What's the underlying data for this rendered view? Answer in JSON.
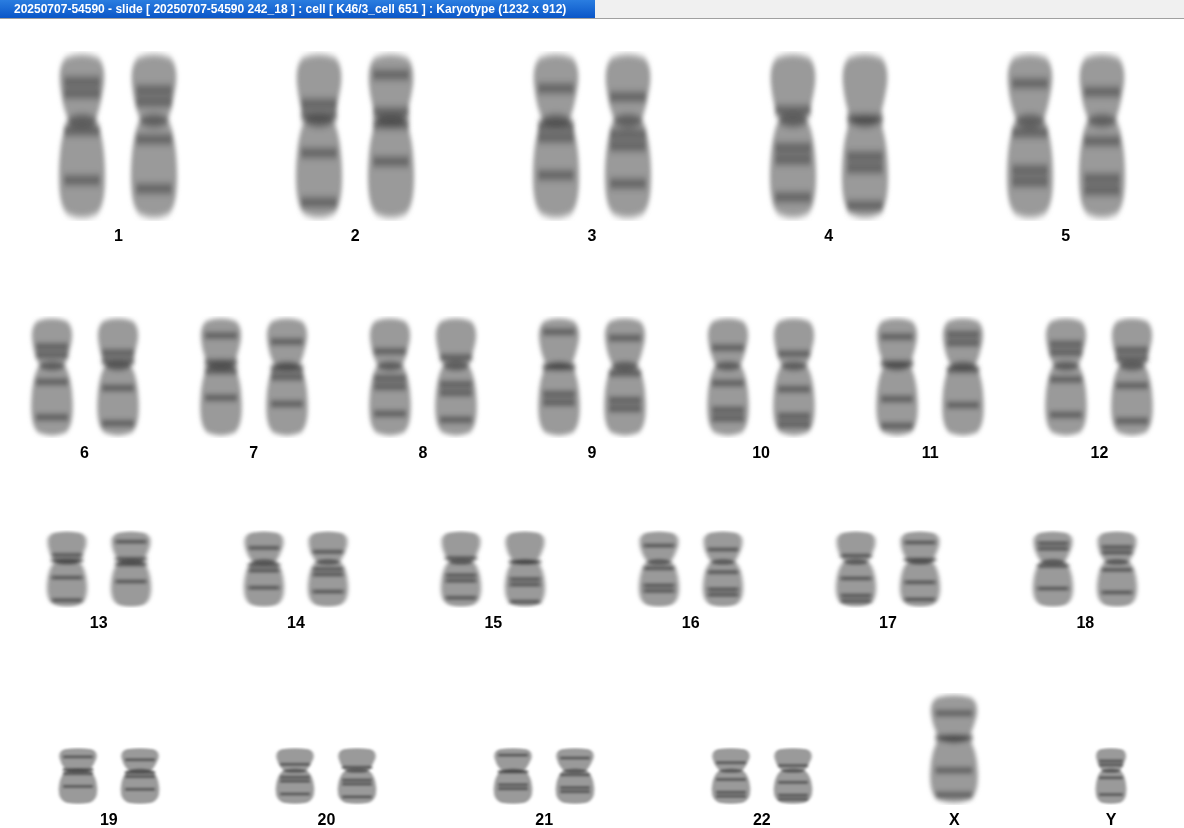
{
  "window": {
    "title": "20250707-54590 - slide [ 20250707-54590 242_18 ] : cell [ K46/3_cell 651 ] : Karyotype  (1232 x 912)"
  },
  "karyotype": {
    "rows": [
      {
        "groups": [
          {
            "label": "1",
            "kind": "pair"
          },
          {
            "label": "2",
            "kind": "pair"
          },
          {
            "label": "3",
            "kind": "pair"
          },
          {
            "label": "4",
            "kind": "pair"
          },
          {
            "label": "5",
            "kind": "pair"
          }
        ]
      },
      {
        "groups": [
          {
            "label": "6",
            "kind": "pair"
          },
          {
            "label": "7",
            "kind": "pair"
          },
          {
            "label": "8",
            "kind": "pair"
          },
          {
            "label": "9",
            "kind": "pair"
          },
          {
            "label": "10",
            "kind": "pair"
          },
          {
            "label": "11",
            "kind": "pair"
          },
          {
            "label": "12",
            "kind": "pair"
          }
        ]
      },
      {
        "groups": [
          {
            "label": "13",
            "kind": "pair"
          },
          {
            "label": "14",
            "kind": "pair"
          },
          {
            "label": "15",
            "kind": "pair"
          },
          {
            "label": "16",
            "kind": "pair"
          },
          {
            "label": "17",
            "kind": "pair"
          },
          {
            "label": "18",
            "kind": "pair"
          }
        ]
      },
      {
        "groups": [
          {
            "label": "19",
            "kind": "pair"
          },
          {
            "label": "20",
            "kind": "pair"
          },
          {
            "label": "21",
            "kind": "pair"
          },
          {
            "label": "22",
            "kind": "pair"
          },
          {
            "label": "X",
            "kind": "large-single"
          },
          {
            "label": "Y",
            "kind": "single"
          }
        ]
      }
    ]
  }
}
